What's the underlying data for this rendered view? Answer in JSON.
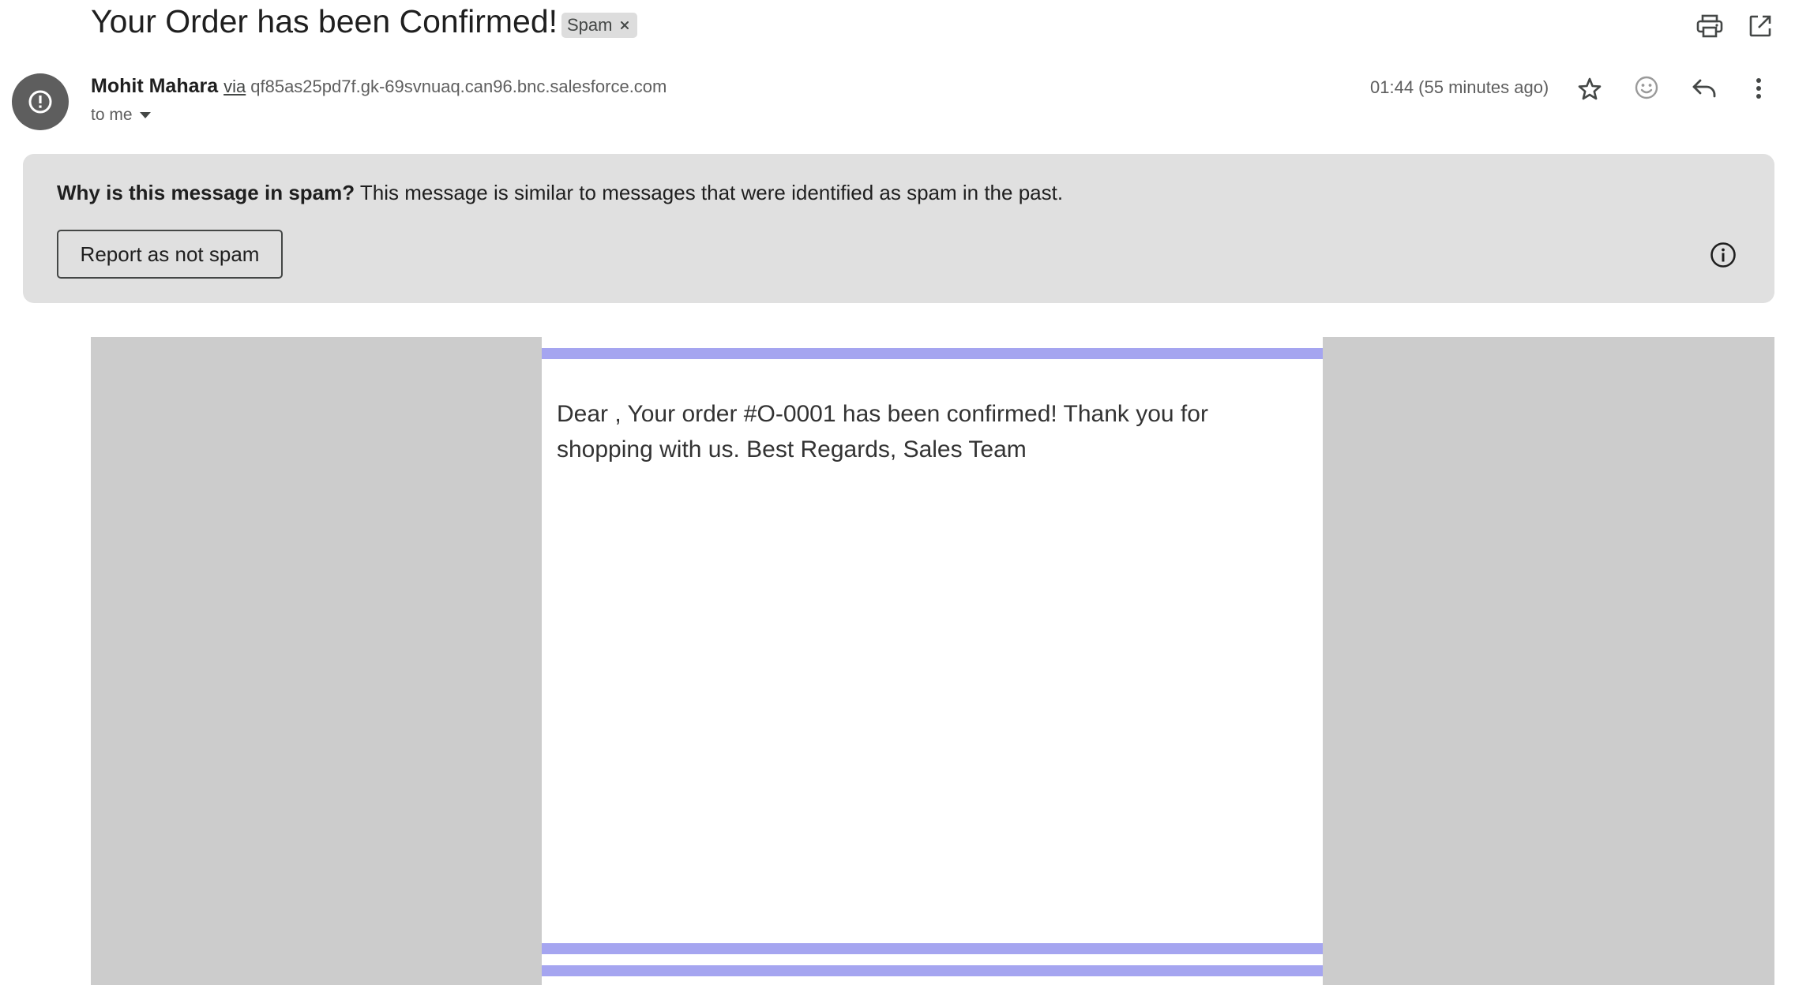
{
  "email": {
    "subject": "Your Order has been Confirmed!",
    "label_chip": "Spam",
    "sender_name": "Mohit Mahara",
    "via_text": "via",
    "via_address": "qf85as25pd7f.gk-69svnuaq.can96.bnc.salesforce.com",
    "recipient_text": "to me",
    "timestamp": "01:44 (55 minutes ago)",
    "body": "Dear , Your order #O-0001 has been confirmed! Thank you for shopping with us. Best Regards, Sales Team"
  },
  "spam_banner": {
    "question": "Why is this message in spam?",
    "explanation": "This message is similar to messages that were identified as spam in the past.",
    "button_label": "Report as not spam"
  },
  "icons": {
    "top_right": [
      "print-icon",
      "open-in-new-window-icon"
    ],
    "actions": [
      "star-icon",
      "emoji-reaction-icon",
      "reply-icon",
      "more-vert-icon"
    ],
    "avatar": "warning-icon",
    "banner": "info-icon"
  },
  "colors": {
    "accent_stripe": "#a5a5f0",
    "banner_bg": "#e0e0e0",
    "avatar_bg": "#5e5e5e",
    "side_gray": "#cccccc"
  }
}
